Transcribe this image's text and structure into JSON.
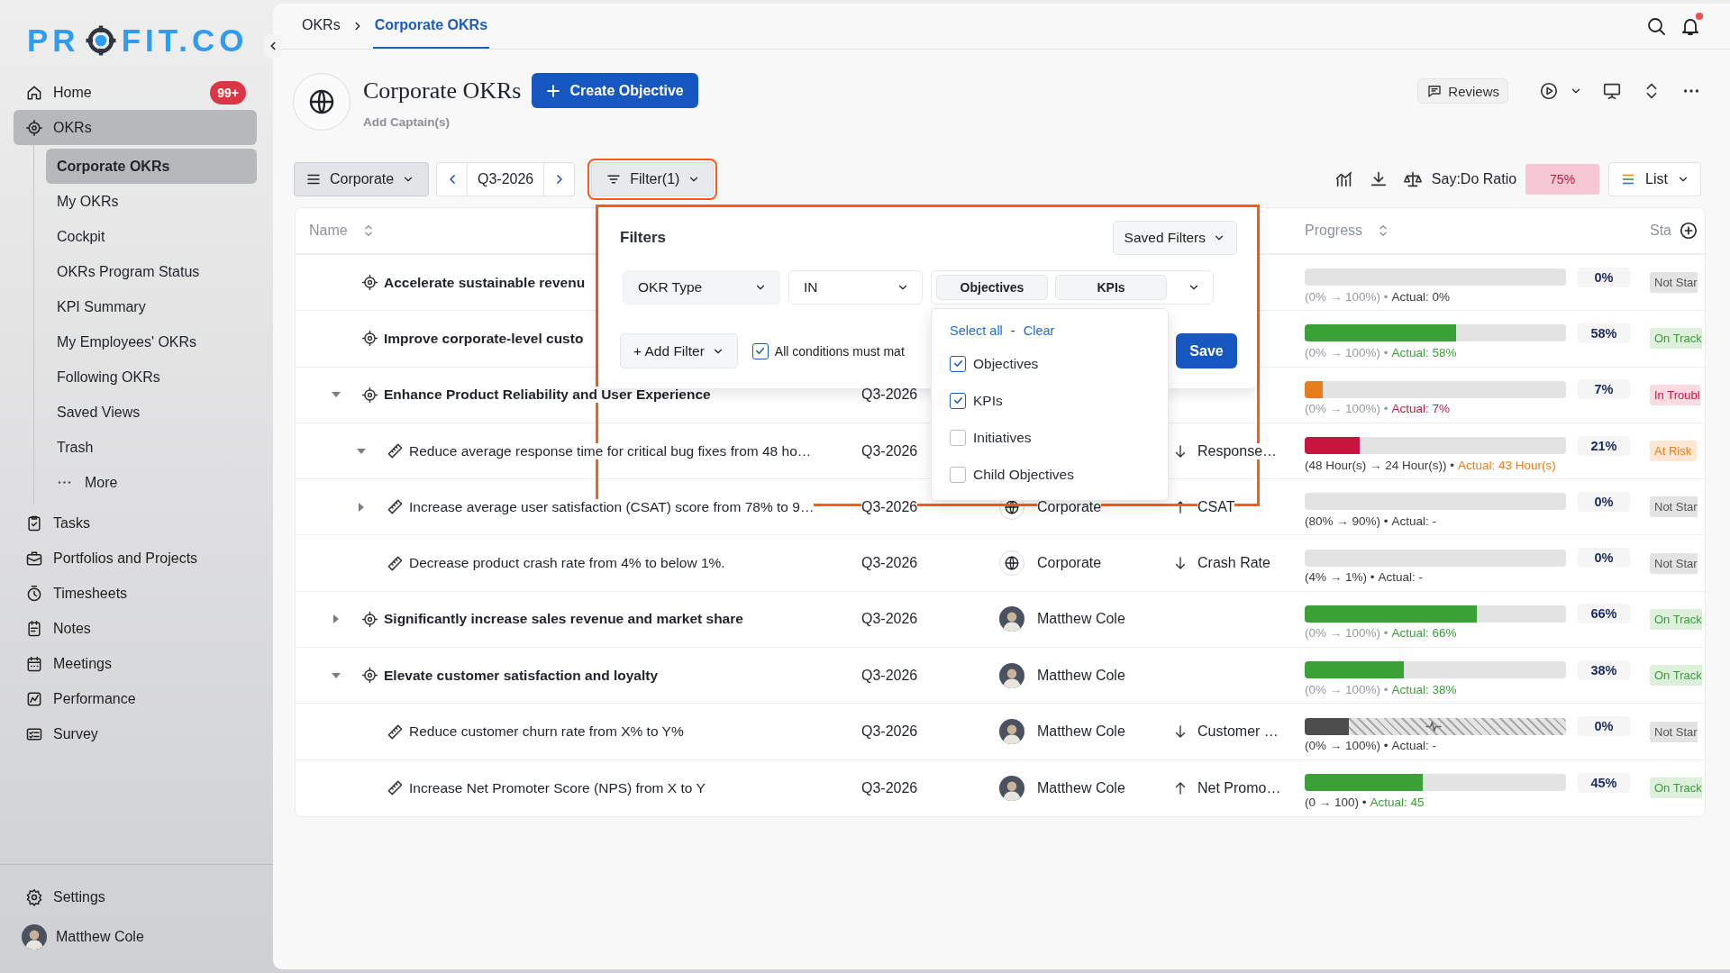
{
  "sidebar": {
    "logo": {
      "before": "PR",
      "after": "FIT.CO"
    },
    "items": [
      {
        "label": "Home",
        "badge": "99+",
        "selected": false
      },
      {
        "label": "OKRs",
        "selected": true,
        "children": [
          {
            "label": "Corporate OKRs",
            "kind": "link",
            "selected": true
          },
          {
            "label": "My OKRs",
            "kind": "link",
            "selected": false
          },
          {
            "label": "Cockpit",
            "kind": "link",
            "selected": false
          },
          {
            "label": "OKRs Program Status",
            "kind": "link",
            "selected": false
          },
          {
            "label": "KPI Summary",
            "kind": "link",
            "selected": false
          },
          {
            "label": "My Employees' OKRs",
            "kind": "link",
            "selected": false
          },
          {
            "label": "Following OKRs",
            "kind": "link",
            "selected": false
          },
          {
            "label": "Saved Views",
            "kind": "link",
            "selected": false
          },
          {
            "label": "Trash",
            "kind": "link",
            "selected": false
          },
          {
            "label": "More",
            "kind": "more",
            "selected": false
          }
        ]
      },
      {
        "label": "Tasks",
        "selected": false
      },
      {
        "label": "Portfolios and Projects",
        "selected": false
      },
      {
        "label": "Timesheets",
        "selected": false
      },
      {
        "label": "Notes",
        "selected": false
      },
      {
        "label": "Meetings",
        "selected": false
      },
      {
        "label": "Performance",
        "selected": false
      },
      {
        "label": "Survey",
        "selected": false
      }
    ],
    "footer": [
      {
        "label": "Settings"
      },
      {
        "label": "Matthew Cole"
      }
    ]
  },
  "topbar": {
    "breadcrumb": [
      {
        "label": "OKRs",
        "selected": false
      },
      {
        "label": "Corporate OKRs",
        "selected": true
      }
    ],
    "notification": true
  },
  "header": {
    "title": "Corporate OKRs",
    "create_button": "Create Objective",
    "captains": "Add Captain(s)",
    "reviews": "Reviews"
  },
  "toolbar": {
    "view": "Corporate",
    "period": "Q3-2026",
    "filter": {
      "label": "Filter(1)",
      "highlighted": true
    },
    "ratio_label": "Say:Do Ratio",
    "ratio": "75%",
    "layout": "List"
  },
  "filter_panel": {
    "highlighted": true,
    "title": "Filters",
    "saved_filters": "Saved Filters",
    "condition": {
      "field": "OKR Type",
      "operator": "IN",
      "values": [
        "Objectives",
        "KPIs"
      ]
    },
    "add_filter": "+ Add Filter",
    "match_all": {
      "label": "All conditions must mat",
      "checked": true
    },
    "save": "Save",
    "dropdown": {
      "select_all": "Select all",
      "separator": "-",
      "clear": "Clear",
      "options": [
        {
          "label": "Objectives",
          "checked": true
        },
        {
          "label": "KPIs",
          "checked": true
        },
        {
          "label": "Initiatives",
          "checked": false
        },
        {
          "label": "Child Objectives",
          "checked": false
        }
      ]
    }
  },
  "table": {
    "columns": [
      {
        "label": "Name",
        "kind": "sortable"
      },
      {
        "label": "Progress",
        "kind": "sortable"
      },
      {
        "label": "Sta",
        "kind": "add"
      }
    ],
    "rows": [
      {
        "kind": "objective",
        "name": "Accelerate sustainable revenu",
        "progress": {
          "kind": "solid",
          "level": 0,
          "percent": "0%",
          "range": "(0% → 100%) •",
          "actual": "Actual: 0%"
        },
        "status": {
          "text": "Not Star",
          "kind": "not_started"
        }
      },
      {
        "kind": "objective",
        "name": "Improve corporate-level custo",
        "progress": {
          "kind": "solid",
          "level": 0.58,
          "percent": "58%",
          "range": "(0% → 100%) •",
          "actual": "Actual: 58%"
        },
        "status": {
          "text": "On Track",
          "kind": "on_track"
        }
      },
      {
        "kind": "objective",
        "name": "Enhance Product Reliability and User Experience",
        "expanded": true,
        "period": "Q3-2026",
        "progress": {
          "kind": "solid",
          "level": 0.07,
          "percent": "7%",
          "range": "(0% → 100%) •",
          "actual": "Actual: 7%"
        },
        "status": {
          "text": "In Troubl",
          "kind": "in_trouble"
        },
        "children": [
          {
            "kind": "key_result",
            "name": "Reduce average response time for critical bug fixes from 48 ho…",
            "expanded": true,
            "period": "Q3-2026",
            "metric": {
              "kind": "down",
              "label": "Response…"
            },
            "progress": {
              "kind": "solid",
              "level": 0.21,
              "percent": "21%",
              "range": "(48 Hour(s) → 24 Hour(s)) •",
              "actual": "Actual: 43 Hour(s)"
            },
            "status": {
              "text": "At Risk",
              "kind": "at_risk"
            }
          },
          {
            "kind": "key_result",
            "name": "Increase average user satisfaction (CSAT) score from 78% to 9…",
            "expanded": false,
            "period": "Q3-2026",
            "owner": {
              "kind": "org",
              "name": "Corporate"
            },
            "metric": {
              "kind": "up",
              "label": "CSAT"
            },
            "progress": {
              "kind": "solid",
              "level": 0,
              "percent": "0%",
              "range": "(80% → 90%) •",
              "actual": "Actual: -"
            },
            "status": {
              "text": "Not Star",
              "kind": "not_started"
            }
          },
          {
            "kind": "key_result",
            "name": "Decrease product crash rate from 4% to below 1%.",
            "period": "Q3-2026",
            "owner": {
              "kind": "org",
              "name": "Corporate"
            },
            "metric": {
              "kind": "down",
              "label": "Crash Rate"
            },
            "progress": {
              "kind": "solid",
              "level": 0,
              "percent": "0%",
              "range": "(4% → 1%) •",
              "actual": "Actual: -"
            },
            "status": {
              "text": "Not Star",
              "kind": "not_started"
            }
          }
        ]
      },
      {
        "kind": "objective",
        "name": "Significantly increase sales revenue and market share",
        "expanded": false,
        "period": "Q3-2026",
        "owner": {
          "kind": "person",
          "name": "Matthew Cole"
        },
        "progress": {
          "kind": "solid",
          "level": 0.66,
          "percent": "66%",
          "range": "(0% → 100%) •",
          "actual": "Actual: 66%"
        },
        "status": {
          "text": "On Track",
          "kind": "on_track"
        }
      },
      {
        "kind": "objective",
        "name": "Elevate customer satisfaction and loyalty",
        "expanded": true,
        "period": "Q3-2026",
        "owner": {
          "kind": "person",
          "name": "Matthew Cole"
        },
        "progress": {
          "kind": "solid",
          "level": 0.38,
          "percent": "38%",
          "range": "(0% → 100%) •",
          "actual": "Actual: 38%"
        },
        "status": {
          "text": "On Track",
          "kind": "on_track"
        },
        "children": [
          {
            "kind": "key_result",
            "name": "Reduce customer churn rate from X% to Y%",
            "period": "Q3-2026",
            "owner": {
              "kind": "person",
              "name": "Matthew Cole"
            },
            "metric": {
              "kind": "down",
              "label": "Customer …"
            },
            "progress": {
              "kind": "hatched",
              "level": 0.17,
              "percent": "0%",
              "range": "(0% → 100%) •",
              "actual": "Actual: -"
            },
            "status": {
              "text": "Not Star",
              "kind": "not_started"
            }
          },
          {
            "kind": "key_result",
            "name": "Increase Net Promoter Score (NPS) from X to Y",
            "period": "Q3-2026",
            "owner": {
              "kind": "person",
              "name": "Matthew Cole"
            },
            "metric": {
              "kind": "up",
              "label": "Net Promo…"
            },
            "progress": {
              "kind": "solid",
              "level": 0.45,
              "percent": "45%",
              "range": "(0 → 100) •",
              "actual": "Actual: 45"
            },
            "status": {
              "text": "On Track",
              "kind": "on_track"
            }
          }
        ]
      }
    ]
  }
}
